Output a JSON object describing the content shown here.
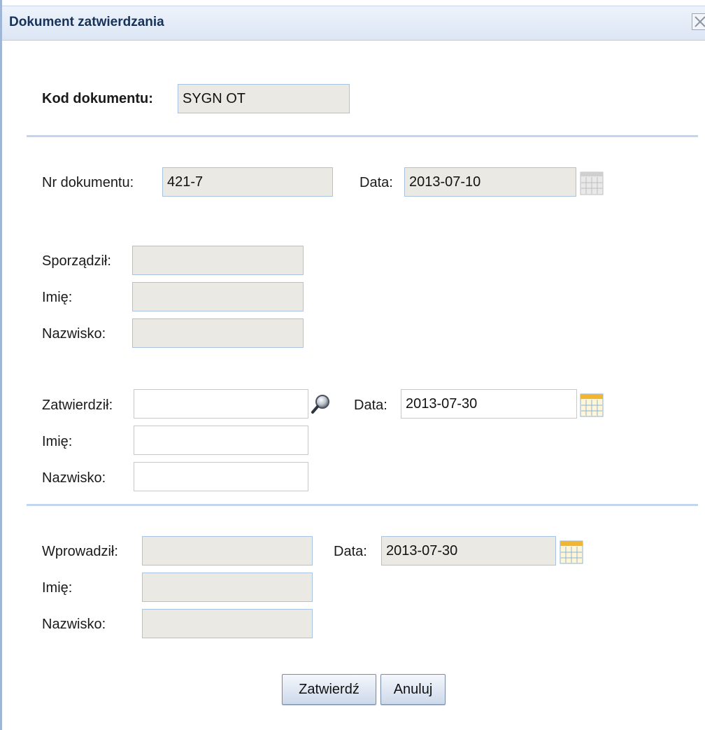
{
  "dialog": {
    "title": "Dokument zatwierdzania"
  },
  "kod": {
    "label": "Kod dokumentu:",
    "value": "SYGN OT"
  },
  "nr": {
    "label": "Nr dokumentu:",
    "value": "421-7",
    "date_label": "Data:",
    "date_value": "2013-07-10"
  },
  "sporzadzil": {
    "label": "Sporządził:",
    "value": "",
    "imie_label": "Imię:",
    "imie_value": "",
    "nazwisko_label": "Nazwisko:",
    "nazwisko_value": ""
  },
  "zatwierdzil": {
    "label": "Zatwierdził:",
    "value": "",
    "date_label": "Data:",
    "date_value": "2013-07-30",
    "imie_label": "Imię:",
    "imie_value": "",
    "nazwisko_label": "Nazwisko:",
    "nazwisko_value": ""
  },
  "wprowadzil": {
    "label": "Wprowadził:",
    "value": "",
    "date_label": "Data:",
    "date_value": "2013-07-30",
    "imie_label": "Imię:",
    "imie_value": "",
    "nazwisko_label": "Nazwisko:",
    "nazwisko_value": ""
  },
  "buttons": {
    "confirm": "Zatwierdź",
    "cancel": "Anuluj"
  },
  "icons": {
    "close": "close-icon",
    "calendar_disabled": "calendar-icon",
    "calendar_active": "calendar-icon",
    "search": "magnifier-icon"
  },
  "colors": {
    "accent": "#c2d6ef",
    "readonly_bg": "#ebe9e4",
    "title_text": "#15325a"
  }
}
